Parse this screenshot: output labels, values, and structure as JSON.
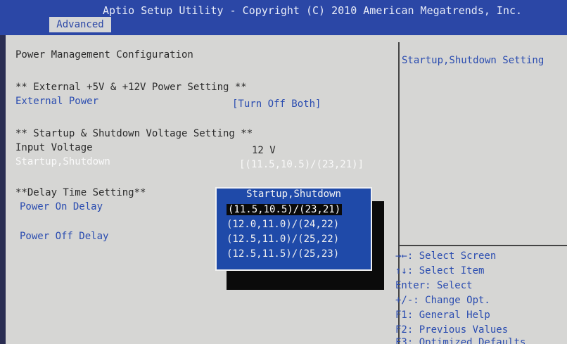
{
  "header": {
    "title": "Aptio Setup Utility - Copyright (C) 2010 American Megatrends, Inc.",
    "tab": "Advanced"
  },
  "main": {
    "section_title": "Power Management Configuration",
    "ext_heading": "** External +5V & +12V Power Setting **",
    "ext_power_label": "External Power",
    "ext_power_value": "[Turn Off Both]",
    "startup_heading": "** Startup & Shutdown Voltage Setting **",
    "input_voltage_label": "Input Voltage",
    "input_voltage_value": "12 V",
    "startup_label": "Startup,Shutdown",
    "startup_value": "[(11.5,10.5)/(23,21)]",
    "delay_heading": "**Delay Time Setting**",
    "power_on_delay_label": "Power On Delay",
    "power_off_delay_label": "Power Off Delay"
  },
  "popup": {
    "title": "Startup,Shutdown",
    "options": [
      "(11.5,10.5)/(23,21)",
      "(12.0,11.0)/(24,22)",
      "(12.5,11.0)/(25,22)",
      "(12.5,11.5)/(25,23)"
    ],
    "selected_index": 0
  },
  "help": {
    "description": "Startup,Shutdown Setting",
    "keys": [
      "→←: Select Screen",
      "↑↓: Select Item",
      "Enter: Select",
      "+/-: Change Opt.",
      "F1: General Help",
      "F2: Previous Values",
      "F3: Optimized Defaults"
    ]
  },
  "colors": {
    "header_bg": "#2b47a6",
    "panel_bg": "#d6d6d4",
    "popup_bg": "#1f4aa9",
    "option_text": "#2a4cb0"
  }
}
